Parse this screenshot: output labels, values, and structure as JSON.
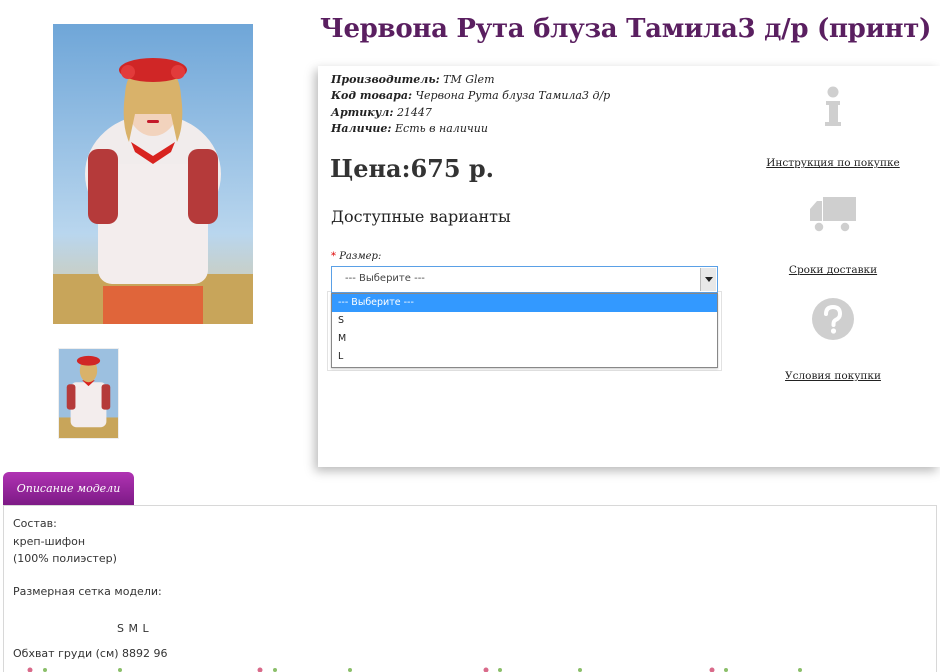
{
  "product": {
    "title": "Червона Рута блуза Тамила3 д/р (принт)",
    "meta": [
      {
        "key": "Производитель:",
        "value": "TM Glem"
      },
      {
        "key": "Код товара:",
        "value": "Червона Рута блуза Тамила3 д/р"
      },
      {
        "key": "Артикул:",
        "value": "21447"
      },
      {
        "key": "Наличие:",
        "value": "Есть в наличии"
      }
    ],
    "price": "Цена:675 р.",
    "variants_heading": "Доступные варианты"
  },
  "size_select": {
    "required_mark": "*",
    "label": "Размер:",
    "selected": "--- Выберите ---",
    "options": [
      "--- Выберите ---",
      "S",
      "M",
      "L"
    ]
  },
  "side_links": {
    "instructions": "Инструкция по покупке",
    "delivery": "Сроки доставки",
    "terms": "Условия покупки"
  },
  "description": {
    "tab": "Описание модели",
    "composition_label": "Состав:",
    "fabric": "креп-шифон",
    "fabric_detail": "(100% полиэстер)",
    "size_chart_label": "Размерная сетка модели:",
    "sizes_row": "S  M  L",
    "chest_row": "Обхват груди (см) 8892 96"
  },
  "colors": {
    "title": "#5a1f60",
    "tab": "#9b2aa0",
    "option_highlight": "#3399ff",
    "icons": "#cfcfcf"
  }
}
